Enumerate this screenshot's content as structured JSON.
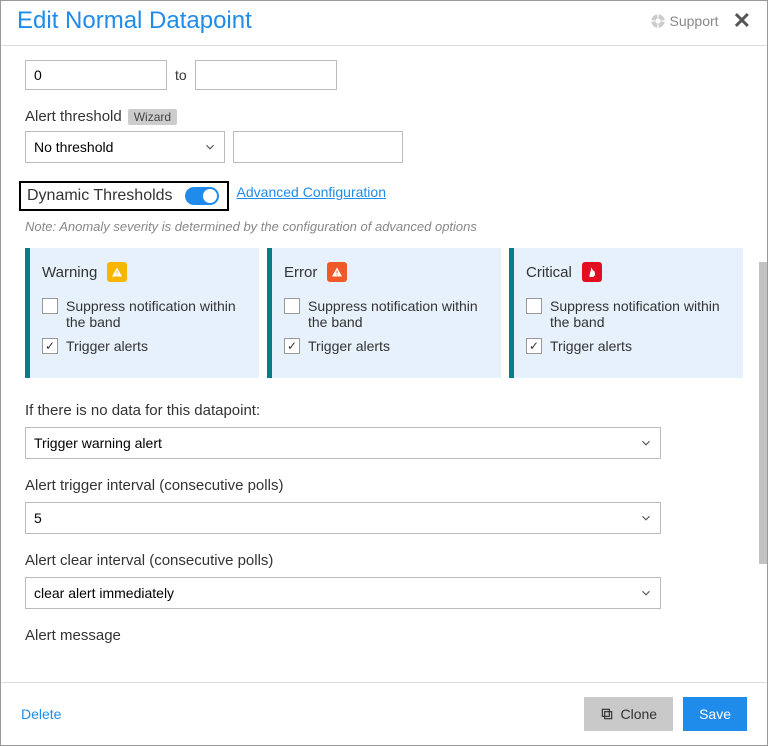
{
  "header": {
    "title": "Edit Normal Datapoint",
    "support": "Support"
  },
  "range": {
    "from": "0",
    "to_label": "to",
    "to": ""
  },
  "alert_threshold": {
    "label": "Alert threshold",
    "wizard": "Wizard",
    "select": "No threshold",
    "value": ""
  },
  "dynamic": {
    "label": "Dynamic Thresholds",
    "advanced": "Advanced Configuration",
    "note": "Note: Anomaly severity is determined by the configuration of advanced options"
  },
  "cards": {
    "warning": "Warning",
    "error": "Error",
    "critical": "Critical",
    "suppress": "Suppress notification within the band",
    "trigger": "Trigger alerts"
  },
  "no_data": {
    "label": "If there is no data for this datapoint:",
    "value": "Trigger warning alert"
  },
  "trigger_interval": {
    "label": "Alert trigger interval (consecutive polls)",
    "value": "5"
  },
  "clear_interval": {
    "label": "Alert clear interval (consecutive polls)",
    "value": "clear alert immediately"
  },
  "alert_message_label": "Alert message",
  "footer": {
    "delete": "Delete",
    "clone": "Clone",
    "save": "Save"
  }
}
